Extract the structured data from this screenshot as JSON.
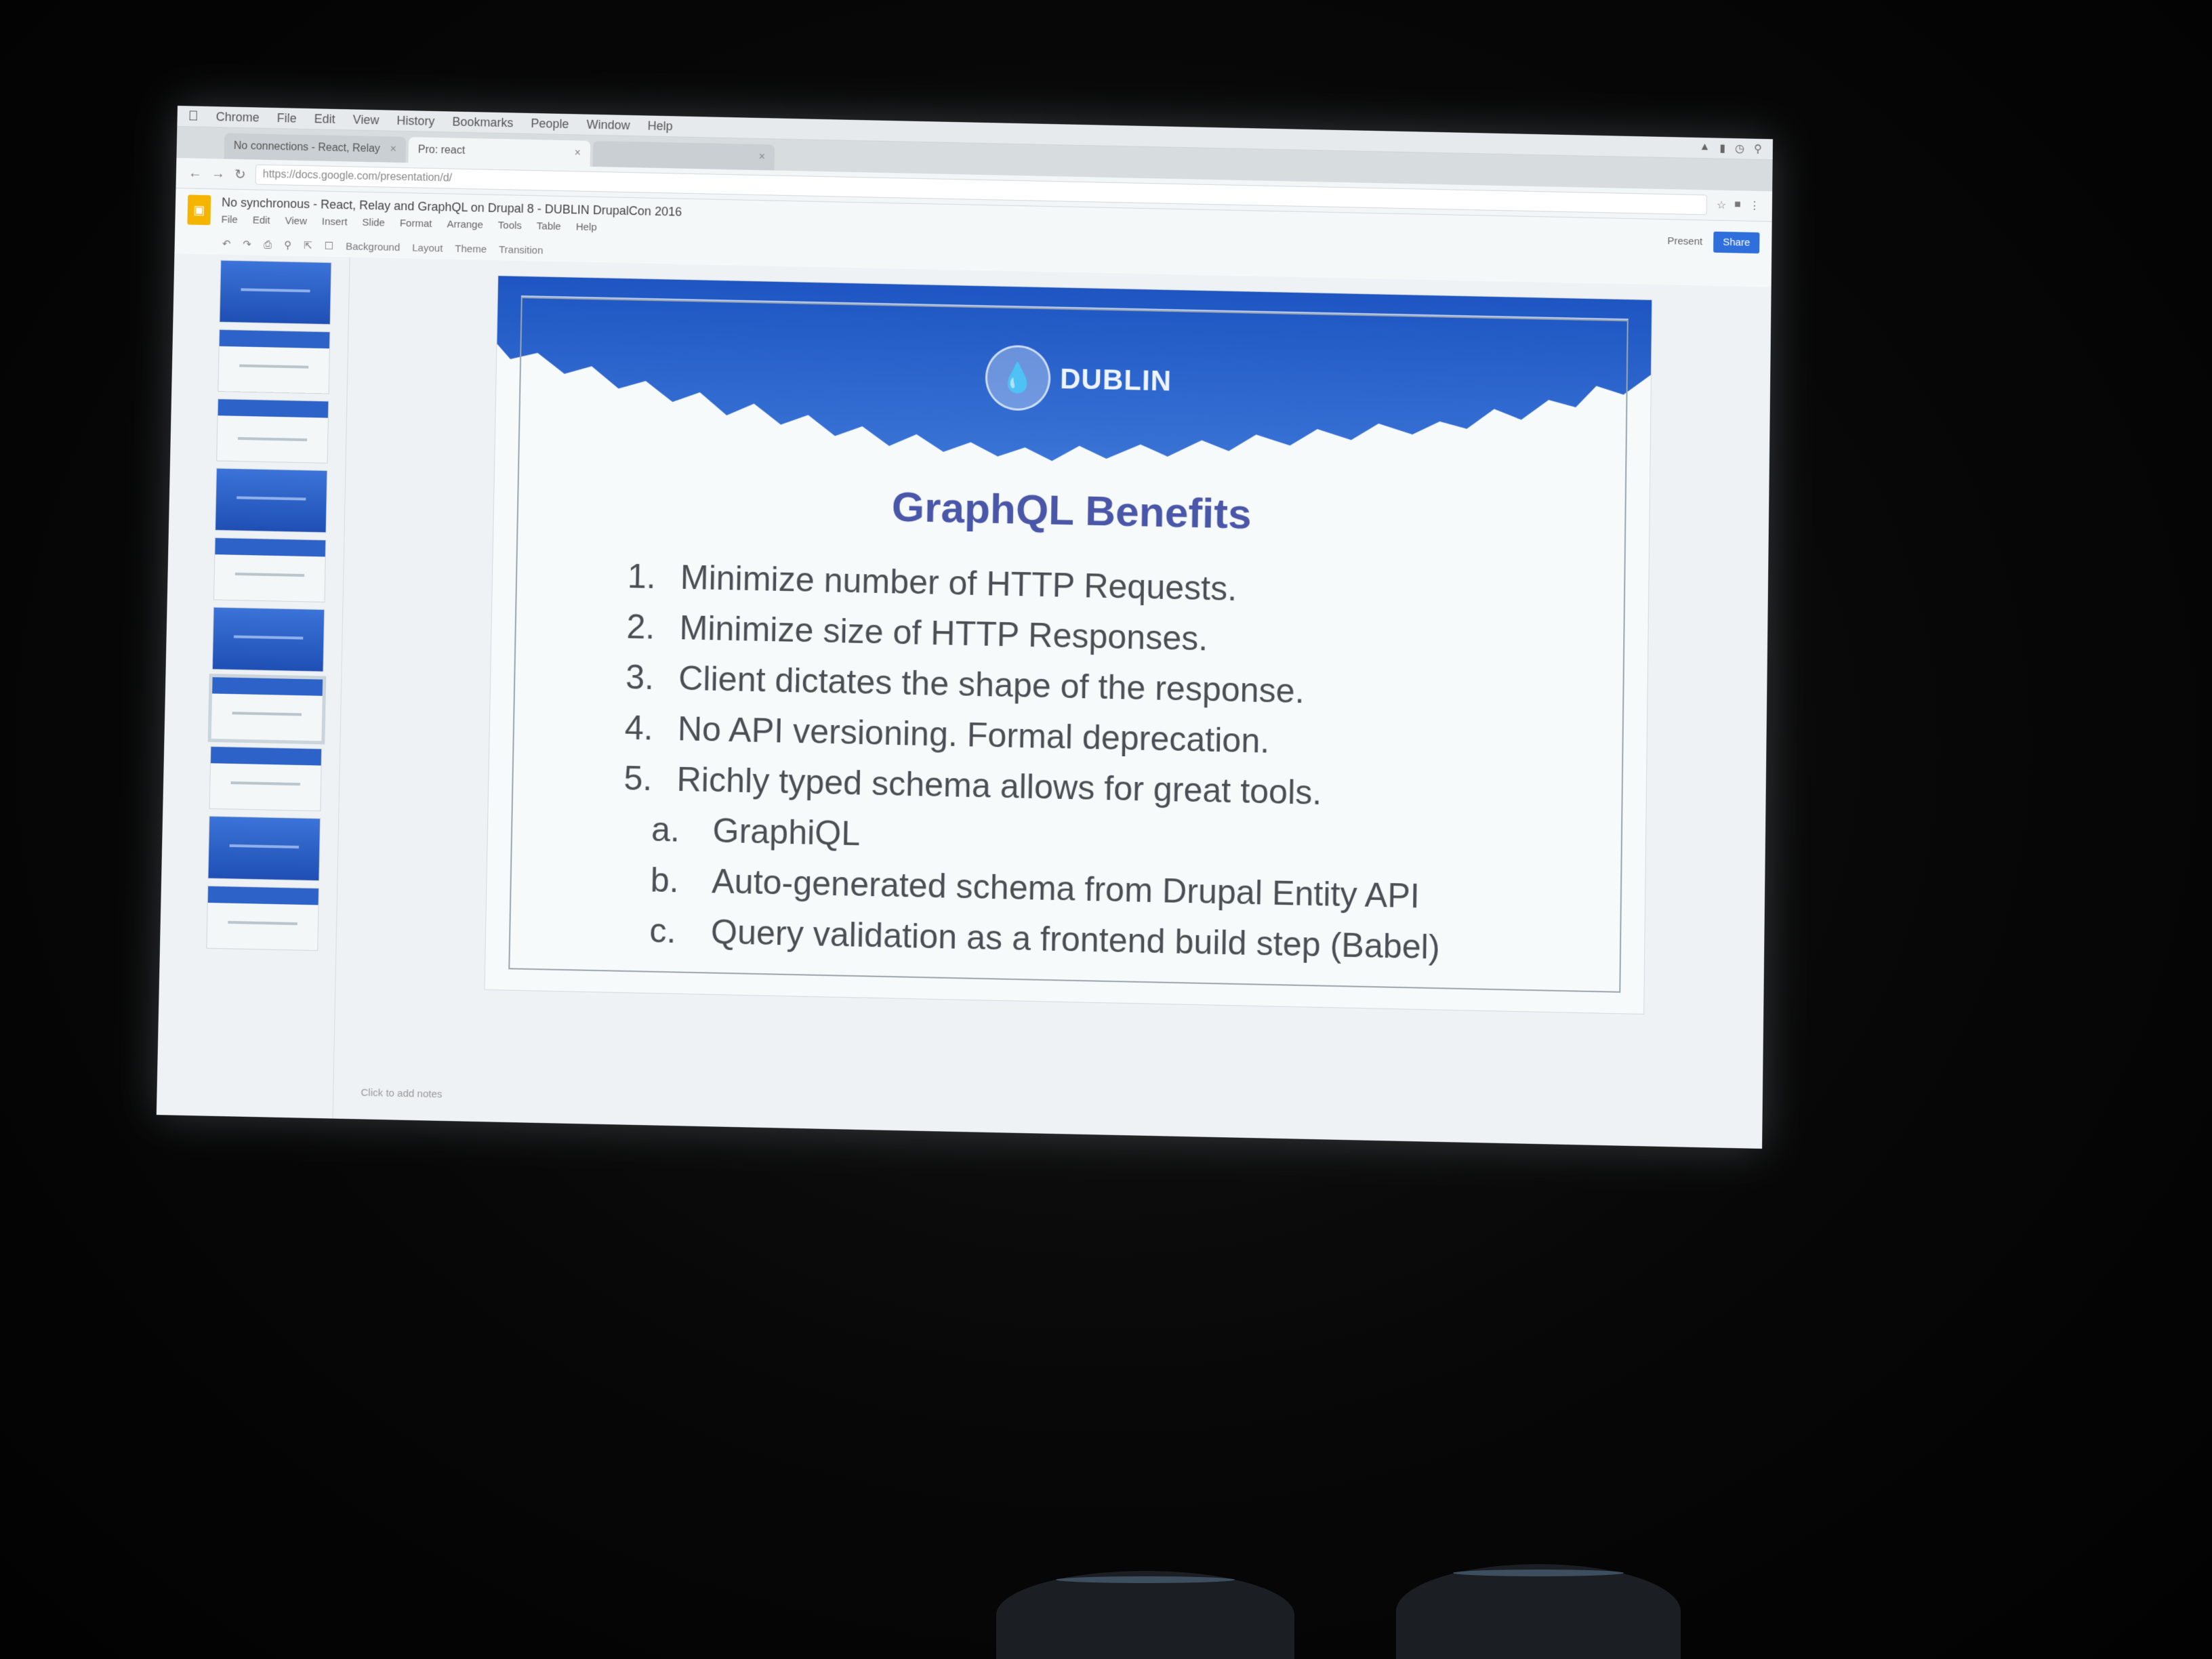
{
  "menubar": {
    "app": "Chrome",
    "items": [
      "File",
      "Edit",
      "View",
      "History",
      "Bookmarks",
      "People",
      "Window",
      "Help"
    ]
  },
  "tabs": [
    {
      "label": "No connections - React, Relay",
      "active": false
    },
    {
      "label": "Pro: react",
      "active": true
    },
    {
      "label": "",
      "active": false
    }
  ],
  "address": {
    "url": "https://docs.google.com/presentation/d/"
  },
  "document": {
    "title": "No synchronous - React, Relay and GraphQL on Drupal 8 - DUBLIN DrupalCon 2016",
    "menu": [
      "File",
      "Edit",
      "View",
      "Insert",
      "Slide",
      "Format",
      "Arrange",
      "Tools",
      "Table",
      "Help"
    ],
    "present_label": "Present",
    "share_label": "Share",
    "toolbar": [
      "Background",
      "Layout",
      "Theme",
      "Transition"
    ]
  },
  "slide": {
    "logo_text": "DUBLIN",
    "title": "GraphQL Benefits",
    "items": [
      {
        "num": "1.",
        "text": "Minimize number of HTTP Requests."
      },
      {
        "num": "2.",
        "text": "Minimize size of HTTP Responses."
      },
      {
        "num": "3.",
        "text": "Client dictates the shape of the response."
      },
      {
        "num": "4.",
        "text": "No API versioning. Formal deprecation."
      },
      {
        "num": "5.",
        "text": "Richly typed schema allows for great tools."
      }
    ],
    "subitems": [
      {
        "num": "a.",
        "text": "GraphiQL"
      },
      {
        "num": "b.",
        "text": "Auto-generated schema from Drupal Entity API"
      },
      {
        "num": "c.",
        "text": "Query validation as a frontend build step (Babel)"
      }
    ]
  },
  "notes": "Click to add notes",
  "colors": {
    "accent": "#2f6fdb",
    "title": "#4a57a8",
    "banner": "#2d62c9"
  }
}
